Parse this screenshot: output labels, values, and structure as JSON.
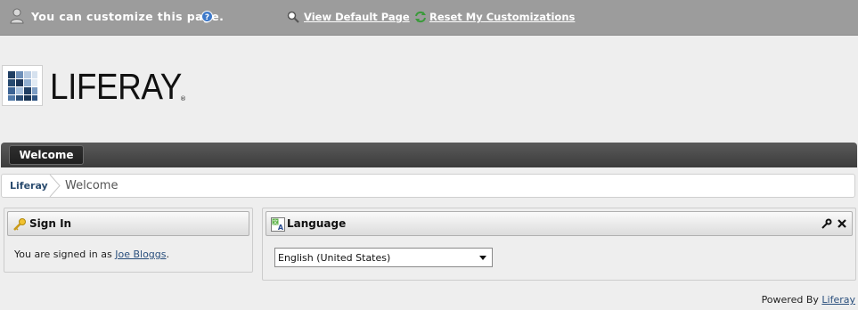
{
  "customize_bar": {
    "message": "You can customize this page.",
    "view_default_label": "View Default Page",
    "reset_label": "Reset My Customizations"
  },
  "logo": {
    "wordmark": "LIFERAY",
    "reg_mark": "®"
  },
  "nav": {
    "tabs": [
      {
        "label": "Welcome"
      }
    ]
  },
  "breadcrumb": {
    "items": [
      {
        "label": "Liferay"
      },
      {
        "label": "Welcome"
      }
    ]
  },
  "signin_portlet": {
    "title": "Sign In",
    "text_prefix": "You are signed in as ",
    "user_name": "Joe Bloggs",
    "text_suffix": "."
  },
  "language_portlet": {
    "title": "Language",
    "selected_language": "English (United States)"
  },
  "footer": {
    "powered_by": "Powered By ",
    "powered_link": "Liferay"
  },
  "colors": {
    "custbar_bg": "#9c9c9c",
    "nav_bg": "#3c3c3c",
    "link": "#2a4f7d"
  }
}
